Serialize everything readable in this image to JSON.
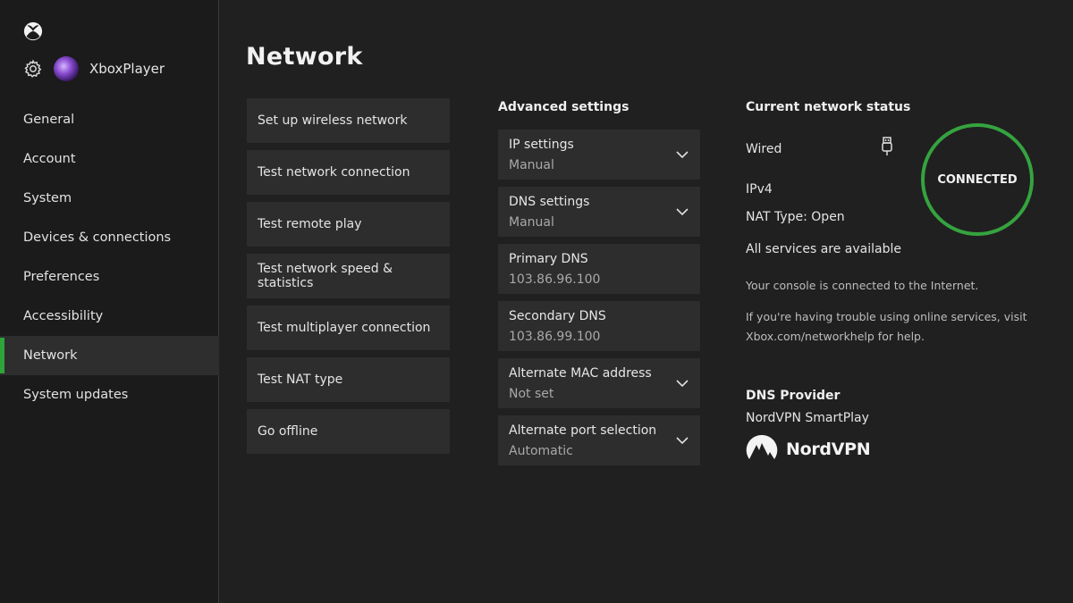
{
  "sidebar": {
    "gamertag": "XboxPlayer",
    "items": [
      {
        "label": "General"
      },
      {
        "label": "Account"
      },
      {
        "label": "System"
      },
      {
        "label": "Devices & connections"
      },
      {
        "label": "Preferences"
      },
      {
        "label": "Accessibility"
      },
      {
        "label": "Network",
        "active": true
      },
      {
        "label": "System updates"
      }
    ]
  },
  "page": {
    "title": "Network"
  },
  "actions": [
    {
      "label": "Set up wireless network"
    },
    {
      "label": "Test network connection"
    },
    {
      "label": "Test remote play"
    },
    {
      "label": "Test network speed & statistics"
    },
    {
      "label": "Test multiplayer connection"
    },
    {
      "label": "Test NAT type"
    },
    {
      "label": "Go offline"
    }
  ],
  "advanced": {
    "heading": "Advanced settings",
    "settings": [
      {
        "label": "IP settings",
        "value": "Manual",
        "dropdown": true
      },
      {
        "label": "DNS settings",
        "value": "Manual",
        "dropdown": true
      },
      {
        "label": "Primary DNS",
        "value": "103.86.96.100",
        "dropdown": false
      },
      {
        "label": "Secondary DNS",
        "value": "103.86.99.100",
        "dropdown": false
      },
      {
        "label": "Alternate MAC address",
        "value": "Not set",
        "dropdown": true
      },
      {
        "label": "Alternate port selection",
        "value": "Automatic",
        "dropdown": true
      }
    ]
  },
  "status": {
    "heading": "Current network status",
    "connection_type": "Wired",
    "ip_version": "IPv4",
    "nat_type": "NAT Type: Open",
    "services": "All services are available",
    "connected_note": "Your console is connected to the Internet.",
    "help_line1": "If you're having trouble using online services, visit",
    "help_line2": "Xbox.com/networkhelp for help.",
    "badge": "CONNECTED"
  },
  "dns_provider": {
    "heading": "DNS Provider",
    "name": "NordVPN SmartPlay",
    "logo_text": "NordVPN"
  },
  "colors": {
    "accent": "#35a33f",
    "background": "#202020",
    "tile": "#2d2d2d"
  },
  "icons": [
    "xbox-logo-icon",
    "gear-icon",
    "chevron-down-icon",
    "usb-plug-icon",
    "nordvpn-logo-icon"
  ]
}
